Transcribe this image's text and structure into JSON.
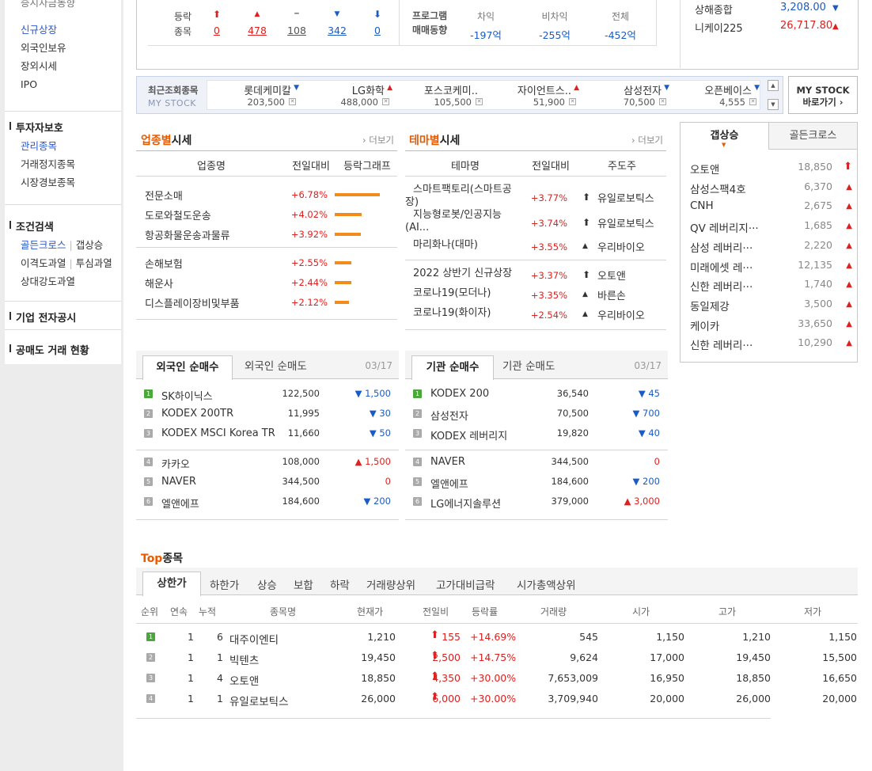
{
  "sidebar": {
    "top_cut": "증시자금동향",
    "group1": [
      "신규상장",
      "외국인보유",
      "장외시세",
      "IPO"
    ],
    "investor_title": "투자자보호",
    "investor_items": [
      "관리종목",
      "거래정지종목",
      "시장경보종목"
    ],
    "search_title": "조건검색",
    "search_items": [
      {
        "a": "골든크로스",
        "b": "갭상승"
      },
      {
        "a": "이격도과열",
        "b": "투심과열"
      },
      {
        "a": "상대강도과열",
        "b": ""
      }
    ],
    "disclosure": "기업 전자공시",
    "short_sell": "공매도 거래 현황"
  },
  "updown": {
    "label1": "등락",
    "label2": "종목",
    "items": [
      {
        "icon": "arrow-up-icon",
        "glyph": "⬆",
        "num": "0",
        "dir": "up"
      },
      {
        "icon": "triangle-up-icon",
        "glyph": "▲",
        "num": "478",
        "dir": "up"
      },
      {
        "icon": "flat-icon",
        "glyph": "━",
        "num": "108",
        "dir": "flat"
      },
      {
        "icon": "triangle-down-icon",
        "glyph": "▼",
        "num": "342",
        "dir": "down"
      },
      {
        "icon": "arrow-down-icon",
        "glyph": "⬇",
        "num": "0",
        "dir": "down"
      }
    ]
  },
  "program": {
    "label1": "프로그램",
    "label2": "매매동향",
    "cols": [
      {
        "label": "차익",
        "value": "-197억"
      },
      {
        "label": "비차익",
        "value": "-255억"
      },
      {
        "label": "전체",
        "value": "-452억"
      }
    ]
  },
  "indices": [
    {
      "name": "상해종합",
      "value": "3,208.00",
      "dir": "down"
    },
    {
      "name": "니케이225",
      "value": "26,717.80",
      "dir": "up"
    }
  ],
  "recent": {
    "label1": "최근조회종목",
    "label2": "MY STOCK",
    "items": [
      {
        "name": "롯데케미칼",
        "price": "203,500",
        "dir": "down"
      },
      {
        "name": "LG화학",
        "price": "488,000",
        "dir": "up"
      },
      {
        "name": "포스코케미..",
        "price": "105,500",
        "dir": "none"
      },
      {
        "name": "자이언트스..",
        "price": "51,900",
        "dir": "up"
      },
      {
        "name": "삼성전자",
        "price": "70,500",
        "dir": "down"
      },
      {
        "name": "오픈베이스",
        "price": "4,555",
        "dir": "down"
      }
    ],
    "mystock_line1": "MY STOCK",
    "mystock_line2": "바로가기 ›"
  },
  "industry": {
    "title_hl": "업종별",
    "title_rest": "시세",
    "more": "더보기",
    "headers": [
      "업종명",
      "전일대비",
      "등락그래프"
    ],
    "rows": [
      {
        "name": "전문소매",
        "pct": "+6.78%",
        "bar": 6.78
      },
      {
        "name": "도로와철도운송",
        "pct": "+4.02%",
        "bar": 4.02
      },
      {
        "name": "항공화물운송과물류",
        "pct": "+3.92%",
        "bar": 3.92
      },
      {
        "name": "손해보험",
        "pct": "+2.55%",
        "bar": 2.55
      },
      {
        "name": "해운사",
        "pct": "+2.44%",
        "bar": 2.44
      },
      {
        "name": "디스플레이장비및부품",
        "pct": "+2.12%",
        "bar": 2.12
      }
    ]
  },
  "theme": {
    "title_hl": "테마별",
    "title_rest": "시세",
    "more": "더보기",
    "headers": [
      "테마명",
      "전일대비",
      "주도주"
    ],
    "rows": [
      {
        "name1": "스마트팩토리(스마트공",
        "name2": "장)",
        "pct": "+3.77%",
        "lead": "유일로보틱스",
        "arrow": "⬆"
      },
      {
        "name1": "지능형로봇/인공지능",
        "name2": "(AI...",
        "pct": "+3.74%",
        "lead": "유일로보틱스",
        "arrow": "⬆"
      },
      {
        "name1": "마리화나(대마)",
        "name2": "",
        "pct": "+3.55%",
        "lead": "우리바이오",
        "arrow": "▲"
      },
      {
        "name1": "2022 상반기 신규상장",
        "name2": "",
        "pct": "+3.37%",
        "lead": "오토앤",
        "arrow": "⬆"
      },
      {
        "name1": "코로나19(모더나)",
        "name2": "",
        "pct": "+3.35%",
        "lead": "바른손",
        "arrow": "▲"
      },
      {
        "name1": "코로나19(화이자)",
        "name2": "",
        "pct": "+2.54%",
        "lead": "우리바이오",
        "arrow": "▲"
      }
    ]
  },
  "gap": {
    "tab_on": "갭상승",
    "tab_off": "골든크로스",
    "rows": [
      {
        "name": "오토앤",
        "price": "18,850",
        "glyph": "⬆"
      },
      {
        "name": "삼성스팩4호",
        "price": "6,370",
        "glyph": "▲"
      },
      {
        "name": "CNH",
        "price": "2,675",
        "glyph": "▲"
      },
      {
        "name": "QV 레버리지···",
        "price": "1,685",
        "glyph": "▲"
      },
      {
        "name": "삼성 레버리···",
        "price": "2,220",
        "glyph": "▲"
      },
      {
        "name": "미래에셋 레···",
        "price": "12,135",
        "glyph": "▲"
      },
      {
        "name": "신한 레버리···",
        "price": "1,740",
        "glyph": "▲"
      },
      {
        "name": "동일제강",
        "price": "3,500",
        "glyph": "▲"
      },
      {
        "name": "케이카",
        "price": "33,650",
        "glyph": "▲"
      },
      {
        "name": "신한 레버리···",
        "price": "10,290",
        "glyph": "▲"
      }
    ]
  },
  "foreign": {
    "tab_on": "외국인 순매수",
    "tab_off": "외국인 순매도",
    "date": "03/17",
    "rows": [
      {
        "rank": "1",
        "name": "SK하이닉스",
        "price": "122,500",
        "chg": "▼ 1,500",
        "dir": "down"
      },
      {
        "rank": "2",
        "name": "KODEX 200TR",
        "price": "11,995",
        "chg": "▼ 30",
        "dir": "down"
      },
      {
        "rank": "3",
        "name": "KODEX MSCI Korea TR",
        "price": "11,660",
        "chg": "▼ 50",
        "dir": "down"
      },
      {
        "rank": "4",
        "name": "카카오",
        "price": "108,000",
        "chg": "▲ 1,500",
        "dir": "up"
      },
      {
        "rank": "5",
        "name": "NAVER",
        "price": "344,500",
        "chg": "0",
        "dir": "up"
      },
      {
        "rank": "6",
        "name": "엘앤에프",
        "price": "184,600",
        "chg": "▼ 200",
        "dir": "down"
      }
    ]
  },
  "institution": {
    "tab_on": "기관 순매수",
    "tab_off": "기관 순매도",
    "date": "03/17",
    "rows": [
      {
        "rank": "1",
        "name": "KODEX 200",
        "price": "36,540",
        "chg": "▼ 45",
        "dir": "down"
      },
      {
        "rank": "2",
        "name": "삼성전자",
        "price": "70,500",
        "chg": "▼ 700",
        "dir": "down"
      },
      {
        "rank": "3",
        "name": "KODEX 레버리지",
        "price": "19,820",
        "chg": "▼ 40",
        "dir": "down"
      },
      {
        "rank": "4",
        "name": "NAVER",
        "price": "344,500",
        "chg": "0",
        "dir": "up"
      },
      {
        "rank": "5",
        "name": "엘앤에프",
        "price": "184,600",
        "chg": "▼ 200",
        "dir": "down"
      },
      {
        "rank": "6",
        "name": "LG에너지솔루션",
        "price": "379,000",
        "chg": "▲ 3,000",
        "dir": "up"
      }
    ]
  },
  "top": {
    "title_hl": "Top",
    "title_rest": "종목",
    "tabs": [
      "상한가",
      "하한가",
      "상승",
      "보합",
      "하락",
      "거래량상위",
      "고가대비급락",
      "시가총액상위"
    ],
    "headers": [
      "순위",
      "연속",
      "누적",
      "종목명",
      "현재가",
      "전일비",
      "등락률",
      "거래량",
      "시가",
      "고가",
      "저가"
    ],
    "rows": [
      {
        "rank": "1",
        "cons": "1",
        "acc": "6",
        "name": "대주이엔티",
        "price": "1,210",
        "chg": "155",
        "rate": "+14.69%",
        "vol": "545",
        "open": "1,150",
        "high": "1,210",
        "low": "1,150"
      },
      {
        "rank": "2",
        "cons": "1",
        "acc": "1",
        "name": "빅텐츠",
        "price": "19,450",
        "chg": "2,500",
        "rate": "+14.75%",
        "vol": "9,624",
        "open": "17,000",
        "high": "19,450",
        "low": "15,500"
      },
      {
        "rank": "3",
        "cons": "1",
        "acc": "4",
        "name": "오토앤",
        "price": "18,850",
        "chg": "4,350",
        "rate": "+30.00%",
        "vol": "7,653,009",
        "open": "16,950",
        "high": "18,850",
        "low": "16,650"
      },
      {
        "rank": "4",
        "cons": "1",
        "acc": "1",
        "name": "유일로보틱스",
        "price": "26,000",
        "chg": "6,000",
        "rate": "+30.00%",
        "vol": "3,709,940",
        "open": "20,000",
        "high": "26,000",
        "low": "20,000"
      }
    ]
  },
  "colors": {
    "up": "#e0201e",
    "down": "#1a5bc4",
    "bar": "#f28b1c",
    "accent": "#e85a00"
  }
}
